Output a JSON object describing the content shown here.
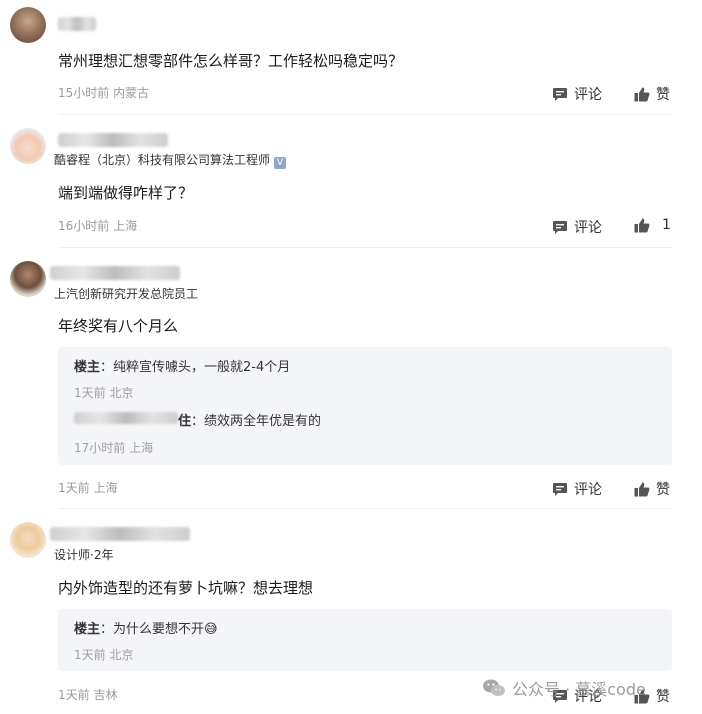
{
  "comments": [
    {
      "company": "",
      "text": "常州理想汇想零部件怎么样哥？工作轻松吗稳定吗？",
      "time": "15小时前",
      "location": "内蒙古",
      "comment_label": "评论",
      "like_label": "赞"
    },
    {
      "company": "酷睿程（北京）科技有限公司算法工程师",
      "verified_badge": "V",
      "text": "端到端做得咋样了？",
      "time": "16小时前",
      "location": "上海",
      "comment_label": "评论",
      "like_label": "1"
    },
    {
      "company": "上汽创新研究开发总院员工",
      "text": "年终奖有八个月么",
      "time": "1天前",
      "location": "上海",
      "comment_label": "评论",
      "like_label": "赞",
      "replies": [
        {
          "author": "楼主",
          "separator": "：",
          "text": "纯粹宣传噱头，一般就2-4个月",
          "time": "1天前",
          "location": "北京"
        },
        {
          "author": "住",
          "separator": "：",
          "text": "绩效两全年优是有的",
          "time": "17小时前",
          "location": "上海"
        }
      ]
    },
    {
      "company": "设计师·2年",
      "text": "内外饰造型的还有萝卜坑嘛？想去理想",
      "time": "1天前",
      "location": "吉林",
      "comment_label": "评论",
      "like_label": "赞",
      "replies": [
        {
          "author": "楼主",
          "separator": "：",
          "text": "为什么要想不开😅",
          "time": "1天前",
          "location": "北京"
        }
      ]
    }
  ],
  "watermark": {
    "text": "公众号 · 慕溪code",
    "icon": "wechat-icon"
  },
  "icons": {
    "comment": "comment-bubble-icon",
    "like": "thumbs-up-icon"
  },
  "colors": {
    "meta_text": "#9a9a9a",
    "reply_background": "#f4f5f9",
    "divider": "#efefef",
    "verified": "#8fa8c8"
  }
}
